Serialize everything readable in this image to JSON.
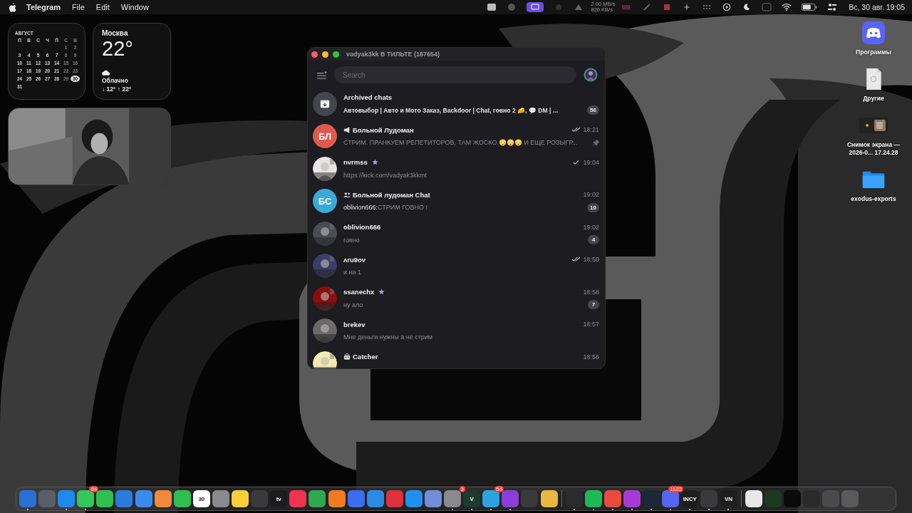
{
  "menu_bar": {
    "app": "Telegram",
    "menus": [
      "File",
      "Edit",
      "Window"
    ],
    "net_up": "2.00 MB/s",
    "net_down": "820 KB/s",
    "clock": "Вс, 30 авг. 19:05"
  },
  "calendar_widget": {
    "month": "АВГУСТ",
    "weekdays": [
      "П",
      "В",
      "С",
      "Ч",
      "П",
      "С",
      "В"
    ],
    "weeks": [
      [
        {
          "day": "1",
          "selected": false
        },
        {
          "day": "2",
          "selected": false
        }
      ],
      [
        {
          "day": "3",
          "selected": false
        },
        {
          "day": "4",
          "selected": false
        },
        {
          "day": "5",
          "selected": false
        },
        {
          "day": "6",
          "selected": false
        },
        {
          "day": "7",
          "selected": false
        },
        {
          "day": "8",
          "selected": false
        },
        {
          "day": "9",
          "selected": false
        }
      ],
      [
        {
          "day": "10",
          "selected": false
        },
        {
          "day": "11",
          "selected": false
        },
        {
          "day": "12",
          "selected": false
        },
        {
          "day": "13",
          "selected": false
        },
        {
          "day": "14",
          "selected": false
        },
        {
          "day": "15",
          "selected": false
        },
        {
          "day": "16",
          "selected": false
        }
      ],
      [
        {
          "day": "17",
          "selected": false
        },
        {
          "day": "18",
          "selected": false
        },
        {
          "day": "19",
          "selected": false
        },
        {
          "day": "20",
          "selected": false
        },
        {
          "day": "21",
          "selected": false
        },
        {
          "day": "22",
          "selected": false
        },
        {
          "day": "23",
          "selected": false
        }
      ],
      [
        {
          "day": "24",
          "selected": false
        },
        {
          "day": "25",
          "selected": false
        },
        {
          "day": "26",
          "selected": false
        },
        {
          "day": "27",
          "selected": false
        },
        {
          "day": "28",
          "selected": false
        },
        {
          "day": "29",
          "selected": false
        },
        {
          "day": "30",
          "selected": true
        }
      ],
      [
        {
          "day": "31",
          "selected": false
        }
      ]
    ]
  },
  "weather_widget": {
    "city": "Москва",
    "temperature": "22°",
    "condition": "Облачно",
    "range": "↓ 12° ↑ 22°"
  },
  "telegram_window": {
    "title": "vadyak3kk В ТИЛЬТЕ (187654)",
    "search": {
      "placeholder": "Search"
    },
    "archived": {
      "title": "Archived chats",
      "preview": "Автовыбор | Авто и Мото Заказ, Backdoor | Chat, говно 2 🧀, 💬 DM | ...",
      "unread": "56"
    },
    "chats": [
      {
        "name": "Больной Лудоман",
        "kind": "channel",
        "premium": false,
        "time": "18:21",
        "outgoing": true,
        "read": true,
        "message": "СТРИМ. ПРАНКУЕМ РЕПЕТИТОРОВ, ТАМ ЖОСКО 😳😳😳 И ЕЩЕ РОЗЫГР...",
        "pinned": true,
        "avatar": {
          "kind": "initials",
          "text": "БЛ",
          "color": "#e0584e"
        }
      },
      {
        "name": "nvrmss",
        "kind": "user",
        "premium": true,
        "time": "19:04",
        "outgoing": true,
        "read": false,
        "message": "https://kick.com/vadyak3kkmt",
        "pinned": false
      },
      {
        "name": "Больной лудоман Chat",
        "kind": "group",
        "premium": false,
        "time": "19:02",
        "outgoing": false,
        "sender": "oblivion666:",
        "message": "СТРИМ ГОВНО !",
        "unread": "10",
        "pinned": false,
        "avatar": {
          "kind": "initials",
          "text": "БС",
          "color": "#3ba9d6"
        }
      },
      {
        "name": "oblivion666",
        "kind": "user",
        "premium": false,
        "time": "19:02",
        "outgoing": false,
        "message": "говно",
        "unread": "4",
        "pinned": false
      },
      {
        "name": "ᴧru9ov",
        "kind": "user",
        "premium": false,
        "time": "18:59",
        "outgoing": true,
        "read": true,
        "message": "и на 1",
        "pinned": false
      },
      {
        "name": "ssanechx",
        "kind": "user",
        "premium": true,
        "time": "18:58",
        "outgoing": false,
        "message": "ну ало",
        "unread": "7",
        "pinned": false
      },
      {
        "name": "brekev",
        "kind": "user",
        "premium": false,
        "time": "18:57",
        "outgoing": false,
        "message": "Мне деньги нужны а не стрим",
        "pinned": false
      },
      {
        "name": "Catcher",
        "kind": "bot",
        "premium": false,
        "time": "18:56",
        "outgoing": false,
        "pinned": false
      }
    ]
  },
  "desktop_icons": [
    {
      "label": "Программы",
      "kind": "app"
    },
    {
      "label": "Другие",
      "kind": "document"
    },
    {
      "label": "Снимок экрана —\n2026-0... 17.24.28",
      "kind": "screenshot"
    },
    {
      "label": "exodus-exports",
      "kind": "folder"
    }
  ],
  "dock": [
    {
      "color": "#2a6fd6",
      "running": true
    },
    {
      "color": "#5a5e66",
      "running": false
    },
    {
      "color": "#1e8af0",
      "running": true
    },
    {
      "color": "#34c759",
      "badge": "84",
      "running": true
    },
    {
      "color": "#2fbf4f",
      "running": false
    },
    {
      "color": "#2a7be0",
      "running": false
    },
    {
      "color": "#3b8cf0",
      "running": false
    },
    {
      "color": "#f08a3c",
      "running": false
    },
    {
      "color": "#2fbf4f",
      "running": false
    },
    {
      "color": "#ffffff",
      "running": false,
      "text": "30"
    },
    {
      "color": "#8a8a8e",
      "running": false
    },
    {
      "color": "#f7d038",
      "running": false
    },
    {
      "color": "#3a3a3c",
      "running": false
    },
    {
      "color": "#1c1c1e",
      "running": false,
      "text": "tv"
    },
    {
      "color": "#f0344f",
      "running": false
    },
    {
      "color": "#2fa84f",
      "running": false
    },
    {
      "color": "#f07a24",
      "running": false
    },
    {
      "color": "#3a6df0",
      "running": false
    },
    {
      "color": "#2b8ae6",
      "running": false
    },
    {
      "color": "#e0303a",
      "running": false
    },
    {
      "color": "#1e90f0",
      "running": false
    },
    {
      "color": "#6f8fd8",
      "running": false
    },
    {
      "color": "#8a8a8e",
      "badge": "3",
      "running": true
    },
    {
      "color": "#1e3b2e",
      "running": true,
      "text": "V"
    },
    {
      "color": "#2aa3e0",
      "badge": "54",
      "running": true
    },
    {
      "color": "#8b3fd8",
      "running": true
    },
    {
      "color": "#3a3a3c",
      "running": false
    },
    {
      "color": "#e8b840",
      "running": false
    },
    {
      "color": "#2c2c2e",
      "running": true
    },
    {
      "color": "#1db954",
      "running": true
    },
    {
      "color": "#e84c3d",
      "running": true
    },
    {
      "color": "#a83ad8",
      "running": true
    },
    {
      "color": "#1b2838",
      "running": true
    },
    {
      "color": "#5865f2",
      "badge": "1122",
      "running": true
    },
    {
      "color": "#1e1e1e",
      "running": true,
      "text": "INCY"
    },
    {
      "color": "#3a3a3c",
      "running": true
    },
    {
      "color": "#1e1e1e",
      "running": true,
      "text": "VN"
    },
    {
      "color": "#e8e8ea",
      "running": false
    },
    {
      "color": "#1c3a22",
      "running": false
    },
    {
      "color": "#0a0a0a",
      "running": false
    },
    {
      "color": "#2a2a2a",
      "running": false
    },
    {
      "color": "#4a4a4c",
      "running": false
    },
    {
      "color": "#5a5a5c",
      "running": false
    }
  ]
}
